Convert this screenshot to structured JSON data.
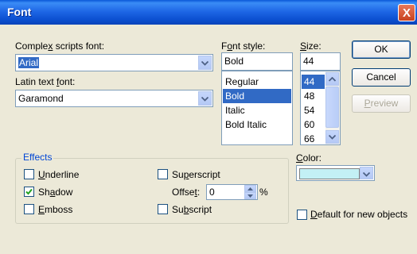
{
  "dialog": {
    "title": "Font",
    "close_glyph": "X"
  },
  "complex": {
    "label_pre": "Comple",
    "label_key": "x",
    "label_post": " scripts font:",
    "value": "Arial"
  },
  "latin": {
    "label_pre": "Latin text ",
    "label_key": "f",
    "label_post": "ont:",
    "value": "Garamond"
  },
  "font_style": {
    "label_pre": "F",
    "label_key": "o",
    "label_post": "nt style:",
    "value": "Bold",
    "options": [
      "Regular",
      "Bold",
      "Italic",
      "Bold Italic"
    ],
    "selected_index": 1
  },
  "size": {
    "label_pre": "",
    "label_key": "S",
    "label_post": "ize:",
    "value": "44",
    "options": [
      "44",
      "48",
      "54",
      "60",
      "66"
    ],
    "selected_index": 0
  },
  "buttons": {
    "ok": "OK",
    "cancel": "Cancel",
    "preview_key": "P",
    "preview_post": "review"
  },
  "effects": {
    "title": "Effects",
    "underline": {
      "key": "U",
      "post": "nderline",
      "checked": false
    },
    "shadow": {
      "pre": "Sh",
      "key": "a",
      "post": "dow",
      "checked": true
    },
    "emboss": {
      "key": "E",
      "post": "mboss",
      "checked": false
    },
    "superscript": {
      "pre": "Su",
      "key": "p",
      "post": "erscript",
      "checked": false
    },
    "subscript": {
      "pre": "Su",
      "key": "b",
      "post": "script",
      "checked": false
    },
    "offset": {
      "pre": "Offse",
      "key": "t",
      "post": ":",
      "value": "0",
      "unit": "%"
    }
  },
  "color": {
    "label_key": "C",
    "label_post": "olor:",
    "swatch": "#c3f0f5"
  },
  "default_new": {
    "key": "D",
    "post": "efault for new objects",
    "checked": false
  },
  "colors": {
    "selection": "#316ac5",
    "titlebar": "#0b4fd0",
    "group_title": "#0046d5",
    "dialog_bg": "#ece9d8"
  }
}
